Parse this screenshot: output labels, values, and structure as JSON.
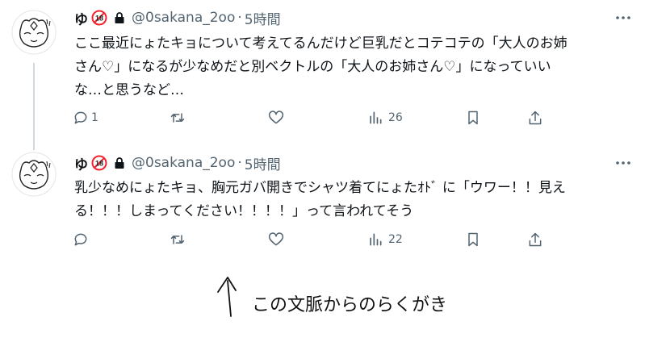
{
  "tweets": [
    {
      "display_name": "ゆ",
      "handle": "@0sakana_2oo",
      "separator": "·",
      "time": "5時間",
      "text": "ここ最近にょたキョについて考えてるんだけど巨乳だとコテコテの「大人のお姉\nさん♡」になるが少なめだと別ベクトルの「大人のお姉さん♡」になっていい\nな…と思うなど…",
      "reply_count": "1",
      "retweet_count": "",
      "like_count": "",
      "views": "26"
    },
    {
      "display_name": "ゆ",
      "handle": "@0sakana_2oo",
      "separator": "·",
      "time": "5時間",
      "text": "乳少なめにょたキョ、胸元ガバ開きでシャツ着てにょたｵﾄﾞ に「ウワー！！見え\nる！！！しまってください！！！！」って言われてそう",
      "reply_count": "",
      "retweet_count": "",
      "like_count": "",
      "views": "22"
    }
  ],
  "handwritten_note": "この文脈からのらくがき",
  "colors": {
    "text": "#0f1419",
    "secondary": "#536471",
    "thread_line": "#cfd9de",
    "age_badge": "#f4212e"
  }
}
